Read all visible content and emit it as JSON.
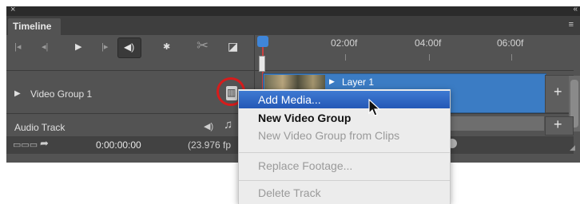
{
  "panel": {
    "title_tab": "Timeline",
    "close_glyph": "×",
    "collapse_glyph": "«",
    "menu_glyph": "≡"
  },
  "icons": {
    "goto_first": "|◂",
    "prev_frame": "◂|",
    "play": "▶",
    "next_frame": "|▸",
    "volume": "◀)",
    "settings": "✱",
    "split": "✂",
    "transition": "◪",
    "playhead": "playhead-icon",
    "film": "▥",
    "expand": "▶",
    "plus": "+",
    "audio_vol": "◀)",
    "audio_note": "♫",
    "render": "▭▭▭",
    "export_arrow": "➦",
    "grip": "◢"
  },
  "ruler": {
    "ticks": [
      "02:00f",
      "04:00f",
      "06:00f"
    ]
  },
  "tracks": {
    "video_group_label": "Video Group 1",
    "layer_label": "Layer 1",
    "audio_label": "Audio Track"
  },
  "footer": {
    "timecode": "0:00:00:00",
    "fps": "(23.976 fp"
  },
  "context_menu": {
    "items": [
      {
        "label": "Add Media...",
        "state": "highlighted"
      },
      {
        "label": "New Video Group",
        "state": "enabled"
      },
      {
        "label": "New Video Group from Clips",
        "state": "disabled"
      },
      {
        "label": "Replace Footage...",
        "state": "disabled"
      },
      {
        "label": "Delete Track",
        "state": "disabled"
      }
    ]
  },
  "colors": {
    "panel_bg": "#535353",
    "track_blue": "#3b7cc4",
    "menu_highlight": "#2f68c4",
    "callout_red": "#d61c1c"
  }
}
